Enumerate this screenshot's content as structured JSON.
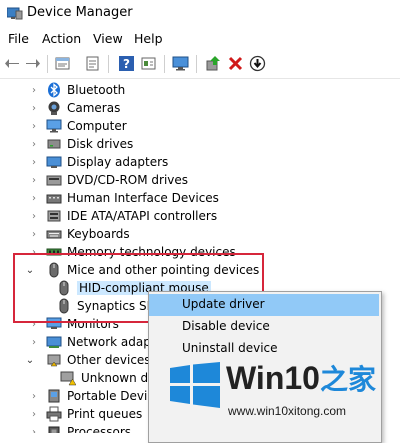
{
  "window": {
    "title": "Device Manager"
  },
  "menu": [
    "File",
    "Action",
    "View",
    "Help"
  ],
  "toolbar_icons": [
    "back-arrow-icon",
    "forward-arrow-icon",
    "properties-icon",
    "scan-icon",
    "help-icon",
    "view-icon",
    "computer-icon",
    "update-driver-icon",
    "uninstall-icon",
    "enable-device-icon"
  ],
  "tree": {
    "items": [
      {
        "label": "Bluetooth",
        "icon": "bluetooth-icon"
      },
      {
        "label": "Cameras",
        "icon": "camera-icon"
      },
      {
        "label": "Computer",
        "icon": "computer-icon"
      },
      {
        "label": "Disk drives",
        "icon": "disk-icon"
      },
      {
        "label": "Display adapters",
        "icon": "display-icon"
      },
      {
        "label": "DVD/CD-ROM drives",
        "icon": "dvd-icon"
      },
      {
        "label": "Human Interface Devices",
        "icon": "hid-icon"
      },
      {
        "label": "IDE ATA/ATAPI controllers",
        "icon": "ide-icon"
      },
      {
        "label": "Keyboards",
        "icon": "keyboard-icon"
      },
      {
        "label": "Memory technology devices",
        "icon": "memory-icon"
      },
      {
        "label": "Mice and other pointing devices",
        "icon": "mouse-icon"
      },
      {
        "label": "HID-compliant mouse",
        "icon": "mouse-icon"
      },
      {
        "label": "Synaptics SM",
        "icon": "mouse-icon"
      },
      {
        "label": "Monitors",
        "icon": "monitor-icon"
      },
      {
        "label": "Network adapte",
        "icon": "network-icon"
      },
      {
        "label": "Other devices",
        "icon": "other-icon"
      },
      {
        "label": "Unknown de",
        "icon": "warning-icon"
      },
      {
        "label": "Portable Devices",
        "icon": "portable-icon"
      },
      {
        "label": "Print queues",
        "icon": "printer-icon"
      },
      {
        "label": "Processors",
        "icon": "cpu-icon"
      }
    ]
  },
  "context_menu": [
    "Update driver",
    "Disable device",
    "Uninstall device"
  ],
  "watermark": {
    "brand": "Win10",
    "brand_suffix": "之家",
    "url": "www.win10xitong.com"
  },
  "colors": {
    "selection": "#cce8ff",
    "highlight_box": "#d6263b",
    "menu_hover": "#91c9f7",
    "win_blue": "#1e88d9"
  }
}
